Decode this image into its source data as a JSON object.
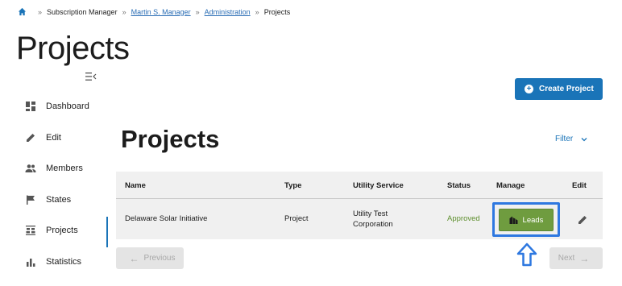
{
  "breadcrumb": {
    "items": [
      "Subscription Manager",
      "Martin S. Manager",
      "Administration",
      "Projects"
    ],
    "separator": "»"
  },
  "page_title": "Projects",
  "create_button": {
    "label": "Create Project"
  },
  "sidebar": {
    "items": [
      {
        "label": "Dashboard",
        "icon": "dashboard-icon"
      },
      {
        "label": "Edit",
        "icon": "pencil-icon"
      },
      {
        "label": "Members",
        "icon": "people-icon"
      },
      {
        "label": "States",
        "icon": "flag-icon"
      },
      {
        "label": "Projects",
        "icon": "solar-panel-icon",
        "active": true
      },
      {
        "label": "Statistics",
        "icon": "bar-chart-icon"
      }
    ]
  },
  "section_title": "Projects",
  "filter": {
    "label": "Filter"
  },
  "table": {
    "headers": [
      "Name",
      "Type",
      "Utility Service",
      "Status",
      "Manage",
      "Edit"
    ],
    "rows": [
      {
        "name": "Delaware Solar Initiative",
        "type": "Project",
        "utility_line1": "Utility Test",
        "utility_line2": "Corporation",
        "status": "Approved",
        "manage_label": "Leads"
      }
    ]
  },
  "pagination": {
    "previous": "Previous",
    "next": "Next"
  },
  "colors": {
    "primary": "#1a74b8",
    "leads_button": "#6f9c3f",
    "approved": "#5e8f2e",
    "highlight_frame": "#2e78e0"
  }
}
